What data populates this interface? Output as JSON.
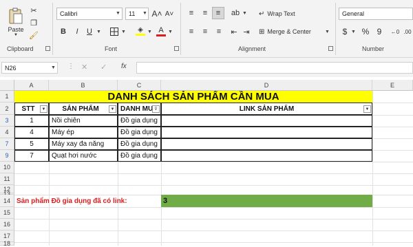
{
  "ribbon": {
    "clipboard": {
      "label": "Clipboard",
      "paste_label": "Paste"
    },
    "font": {
      "label": "Font",
      "name": "Calibri",
      "size": "11",
      "grow_icon": "A˄",
      "shrink_icon": "A˅",
      "bold": "B",
      "italic": "I",
      "underline": "U"
    },
    "alignment": {
      "label": "Alignment",
      "wrap_text": "Wrap Text",
      "merge_center": "Merge & Center"
    },
    "number": {
      "label": "Number",
      "format": "General",
      "currency": "$",
      "percent": "%",
      "comma": "9"
    }
  },
  "formula_bar": {
    "name_box": "N26",
    "fx": "fx",
    "value": ""
  },
  "columns": [
    "A",
    "B",
    "C",
    "D",
    "E"
  ],
  "rows": [
    "1",
    "2",
    "3",
    "4",
    "7",
    "9",
    "10",
    "11",
    "12",
    "13",
    "14",
    "15",
    "16",
    "17",
    "18"
  ],
  "sheet": {
    "title": "DANH SÁCH SẢN PHẨM CẦN MUA",
    "headers": {
      "stt": "STT",
      "product": "SẢN PHẨM",
      "category": "DANH MU",
      "link": "LINK SẢN PHẨM"
    },
    "items": [
      {
        "stt": "1",
        "product": "Nồi chiên",
        "category": "Đồ gia dụng"
      },
      {
        "stt": "4",
        "product": "Máy ép",
        "category": "Đồ gia dụng"
      },
      {
        "stt": "5",
        "product": "Máy xay đa năng",
        "category": "Đồ gia dụng"
      },
      {
        "stt": "7",
        "product": "Quạt hơi nước",
        "category": "Đồ gia dụng"
      }
    ],
    "summary_label": "Sản phẩm Đồ gia dụng đã có link:",
    "summary_value": "3"
  },
  "colors": {
    "title_fill": "#ffff00",
    "summary_fill": "#70ad47",
    "summary_text": "#e01b1b",
    "row_blue": "#2f5fb3"
  }
}
